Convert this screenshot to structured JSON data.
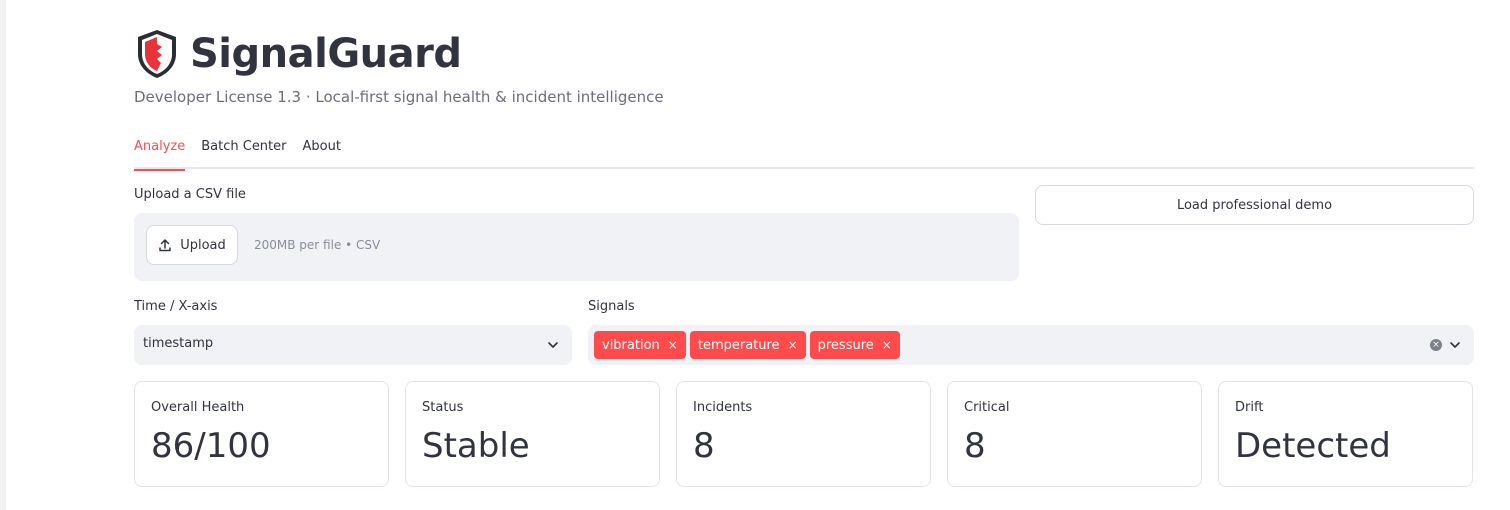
{
  "app": {
    "title": "SignalGuard",
    "subtitle": "Developer License 1.3 · Local-first signal health & incident intelligence",
    "icon": "shield-icon",
    "accent_color": "#ff4b4b"
  },
  "tabs": [
    {
      "label": "Analyze",
      "active": true
    },
    {
      "label": "Batch Center",
      "active": false
    },
    {
      "label": "About",
      "active": false
    }
  ],
  "uploader": {
    "label": "Upload a CSV file",
    "button_label": "Upload",
    "button_icon": "upload-icon",
    "hint": "200MB per file • CSV"
  },
  "demo_button": {
    "label": "Load professional demo"
  },
  "time_axis": {
    "label": "Time / X-axis",
    "value": "timestamp",
    "icon": "chevron-down-icon"
  },
  "signals": {
    "label": "Signals",
    "selected": [
      "vibration",
      "temperature",
      "pressure"
    ],
    "remove_glyph": "×",
    "clear_icon": "clear-icon",
    "dropdown_icon": "chevron-down-icon"
  },
  "metrics": [
    {
      "label": "Overall Health",
      "value": "86/100"
    },
    {
      "label": "Status",
      "value": "Stable"
    },
    {
      "label": "Incidents",
      "value": "8"
    },
    {
      "label": "Critical",
      "value": "8"
    },
    {
      "label": "Drift",
      "value": "Detected"
    }
  ]
}
